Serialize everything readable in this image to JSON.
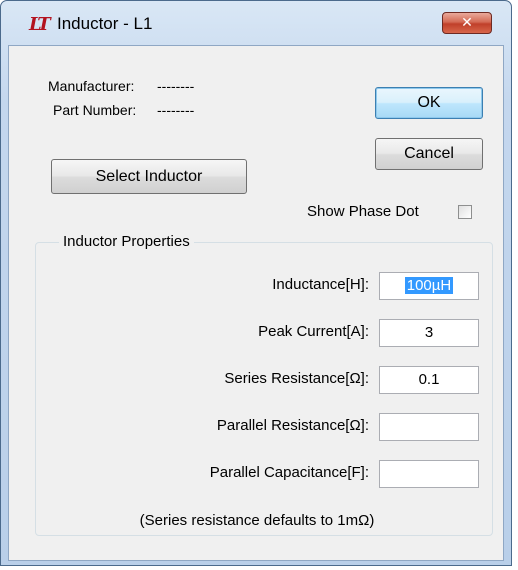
{
  "window": {
    "app_icon_glyph": "LT",
    "title": "Inductor - L1",
    "close_glyph": "✕"
  },
  "header": {
    "manufacturer_label": "Manufacturer:",
    "manufacturer_value": "--------",
    "part_number_label": "Part Number:",
    "part_number_value": "--------",
    "select_button": "Select Inductor",
    "ok_button": "OK",
    "cancel_button": "Cancel",
    "show_phase_dot_label": "Show Phase Dot",
    "show_phase_dot_checked": false
  },
  "properties": {
    "group_title": "Inductor Properties",
    "fields": [
      {
        "label": "Inductance[H]:",
        "value": "100µH",
        "selected": true
      },
      {
        "label": "Peak Current[A]:",
        "value": "3"
      },
      {
        "label": "Series Resistance[Ω]:",
        "value": "0.1"
      },
      {
        "label": "Parallel Resistance[Ω]:",
        "value": ""
      },
      {
        "label": "Parallel Capacitance[F]:",
        "value": ""
      }
    ],
    "note": "(Series resistance defaults to 1mΩ)"
  },
  "colors": {
    "title_bar": "#c4d7ee",
    "close_button": "#c0402a",
    "selection": "#3399ff",
    "app_icon": "#b3121f"
  }
}
